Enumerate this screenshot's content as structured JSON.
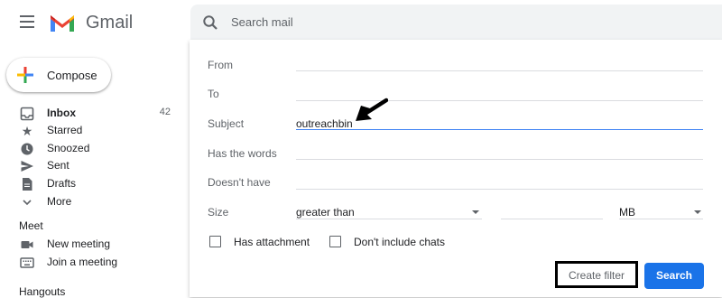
{
  "app": {
    "name": "Gmail"
  },
  "compose_label": "Compose",
  "nav": [
    {
      "label": "Inbox",
      "count": "42",
      "icon": "inbox-icon"
    },
    {
      "label": "Starred",
      "icon": "star-icon"
    },
    {
      "label": "Snoozed",
      "icon": "clock-icon"
    },
    {
      "label": "Sent",
      "icon": "send-icon"
    },
    {
      "label": "Drafts",
      "icon": "draft-icon"
    },
    {
      "label": "More",
      "icon": "chevron-down-icon"
    }
  ],
  "meet": {
    "title": "Meet",
    "items": [
      {
        "label": "New meeting",
        "icon": "video-icon"
      },
      {
        "label": "Join a meeting",
        "icon": "keyboard-icon"
      }
    ]
  },
  "hangouts": {
    "title": "Hangouts"
  },
  "search": {
    "placeholder": "Search mail"
  },
  "filter": {
    "from_label": "From",
    "from_value": "",
    "to_label": "To",
    "to_value": "",
    "subject_label": "Subject",
    "subject_value": "outreachbin",
    "has_words_label": "Has the words",
    "has_words_value": "",
    "doesnt_have_label": "Doesn't have",
    "doesnt_have_value": "",
    "size_label": "Size",
    "size_operator": "greater than",
    "size_value": "",
    "size_unit": "MB",
    "has_attachment_label": "Has attachment",
    "has_attachment_checked": false,
    "dont_include_chats_label": "Don't include chats",
    "dont_include_chats_checked": false,
    "create_filter_label": "Create filter",
    "search_button_label": "Search"
  },
  "colors": {
    "accent": "#1a73e8",
    "focus_line": "#4285f4"
  }
}
